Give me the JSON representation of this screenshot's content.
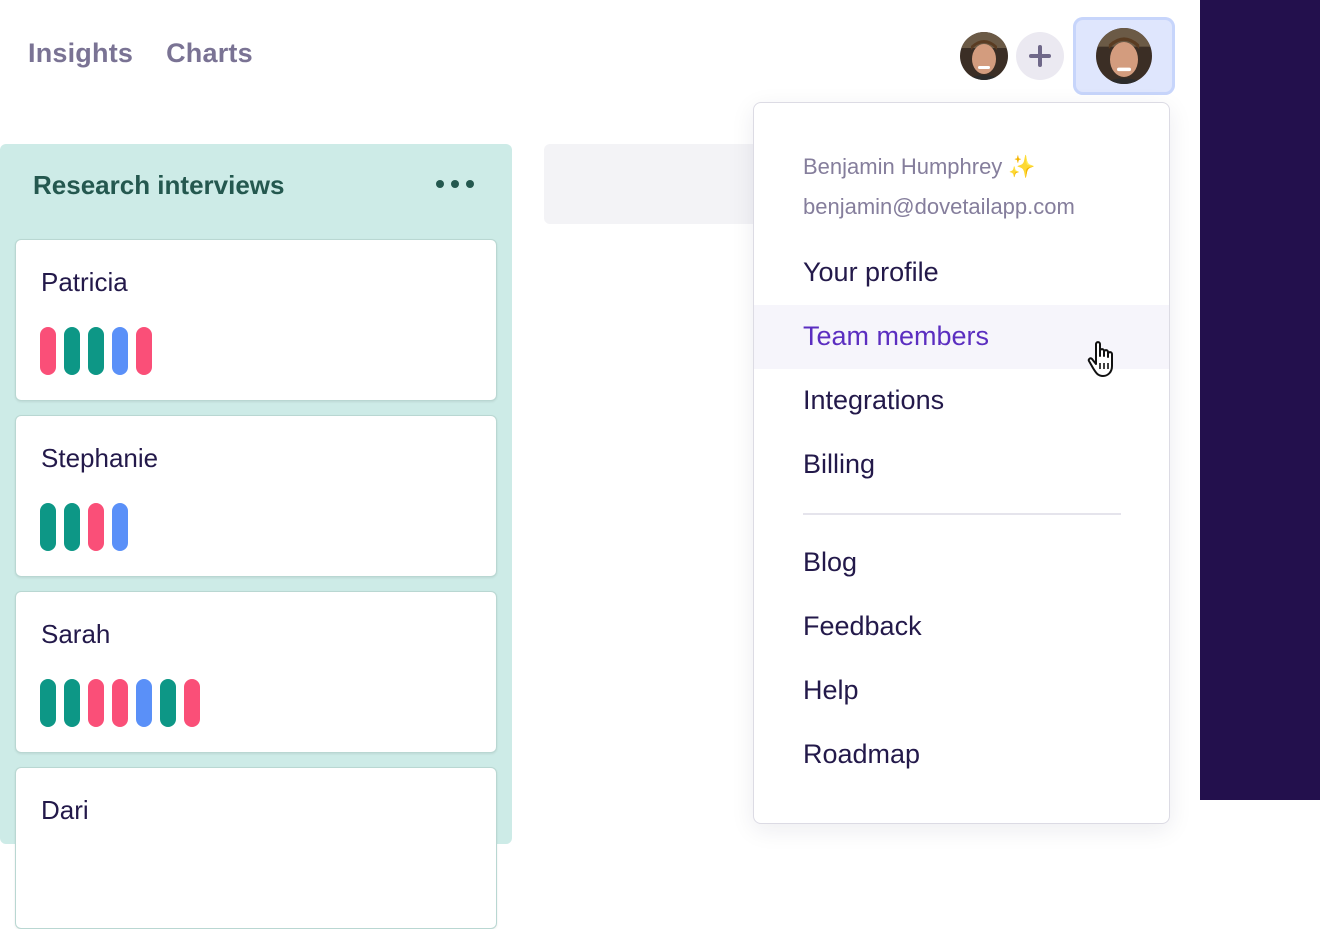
{
  "nav": {
    "tab1": "Insights",
    "tab2": "Charts"
  },
  "board": {
    "column_title": "Research interviews",
    "cards": [
      {
        "name": "Patricia",
        "tags": [
          "#fa4f78",
          "#0d9786",
          "#0d9786",
          "#5a90f8",
          "#fa4f78"
        ]
      },
      {
        "name": "Stephanie",
        "tags": [
          "#0d9786",
          "#0d9786",
          "#fa4f78",
          "#5a90f8"
        ]
      },
      {
        "name": "Sarah",
        "tags": [
          "#0d9786",
          "#0d9786",
          "#fa4f78",
          "#fa4f78",
          "#5a90f8",
          "#0d9786",
          "#fa4f78"
        ]
      },
      {
        "name": "Dari",
        "tags": []
      }
    ]
  },
  "user_menu": {
    "name": "Benjamin Humphrey ✨",
    "email": "benjamin@dovetailapp.com",
    "items": [
      "Your profile",
      "Team members",
      "Integrations",
      "Billing"
    ],
    "items2": [
      "Blog",
      "Feedback",
      "Help",
      "Roadmap"
    ]
  },
  "colors": {
    "accent": "#5b2ec0",
    "sidebar": "#23104d",
    "column_bg": "#cdebe7"
  }
}
